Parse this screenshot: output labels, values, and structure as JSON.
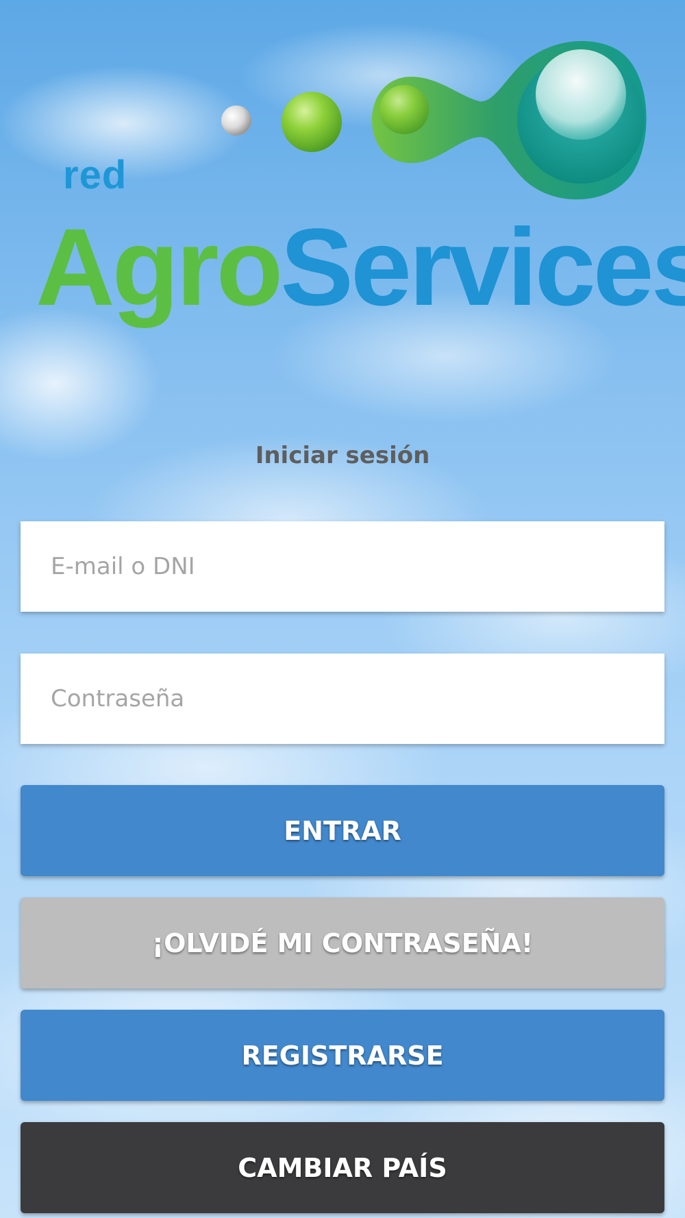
{
  "logo": {
    "prefix": "red",
    "word_part1": "Agro",
    "word_part2": "Services"
  },
  "login": {
    "title": "Iniciar sesión",
    "email_placeholder": "E-mail o DNI",
    "password_placeholder": "Contraseña"
  },
  "buttons": {
    "enter": "ENTRAR",
    "forgot": "¡OLVIDÉ MI CONTRASEÑA!",
    "register": "REGISTRARSE",
    "change_country": "CAMBIAR PAÍS"
  },
  "colors": {
    "primary_button": "#4288cc",
    "secondary_button": "#bdbdbd",
    "dark_button": "#3b3b3d",
    "logo_green": "#5cbf43",
    "logo_blue": "#1f93d4"
  }
}
